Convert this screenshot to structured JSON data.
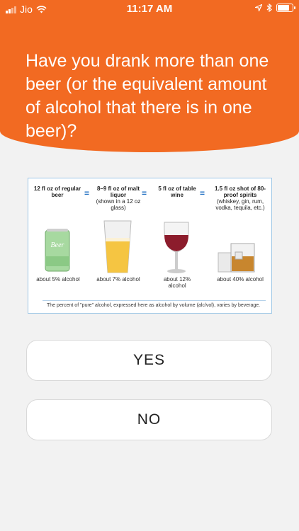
{
  "status_bar": {
    "carrier": "Jio",
    "time": "11:17 AM",
    "battery_level": 0.9
  },
  "question": "Have you drank more than one beer (or the equivalent amount of alcohol that there is in one beer)?",
  "infographic": {
    "columns": [
      {
        "title": "12 fl oz of regular beer",
        "sub": "",
        "pct": "about 5% alcohol"
      },
      {
        "title": "8–9 fl oz of malt liquor",
        "sub": "(shown in a 12 oz glass)",
        "pct": "about 7% alcohol"
      },
      {
        "title": "5 fl oz of table wine",
        "sub": "",
        "pct": "about 12% alcohol"
      },
      {
        "title": "1.5 fl oz shot of 80-proof spirits",
        "sub": "(whiskey, gin, rum, vodka, tequila, etc.)",
        "pct": "about 40% alcohol"
      }
    ],
    "equals": "=",
    "can_text": "Beer",
    "footnote": "The percent of \"pure\" alcohol, expressed here as alcohol by volume (alc/vol), varies by beverage."
  },
  "answers": {
    "yes": "YES",
    "no": "NO"
  },
  "colors": {
    "accent": "#f26a22",
    "background": "#f2f2f2"
  }
}
